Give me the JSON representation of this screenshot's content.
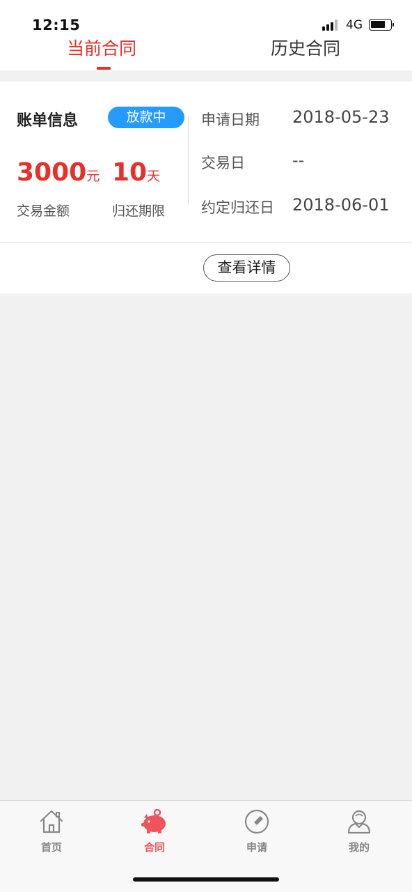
{
  "status_bar": {
    "time": "12:15",
    "network": "4G"
  },
  "tabs": [
    {
      "label": "当前合同",
      "active": true
    },
    {
      "label": "历史合同",
      "active": false
    }
  ],
  "bill": {
    "title": "账单信息",
    "status": "放款中",
    "amount": "3000",
    "amount_unit": "元",
    "amount_label": "交易金额",
    "term": "10",
    "term_unit": "天",
    "term_label": "归还期限",
    "rows": [
      {
        "label": "申请日期",
        "value": "2018-05-23"
      },
      {
        "label": "交易日",
        "value": "--"
      },
      {
        "label": "约定归还日",
        "value": "2018-06-01"
      }
    ],
    "details_button": "查看详情"
  },
  "tabbar": [
    {
      "label": "首页",
      "icon": "home-icon",
      "active": false
    },
    {
      "label": "合同",
      "icon": "piggy-bank-icon",
      "active": true
    },
    {
      "label": "申请",
      "icon": "pencil-icon",
      "active": false
    },
    {
      "label": "我的",
      "icon": "user-icon",
      "active": false
    }
  ],
  "colors": {
    "accent": "#e8302a",
    "badge": "#259aff",
    "tab_active": "#f0545a",
    "tab_inactive": "#888888",
    "background": "#f1f1f1"
  }
}
